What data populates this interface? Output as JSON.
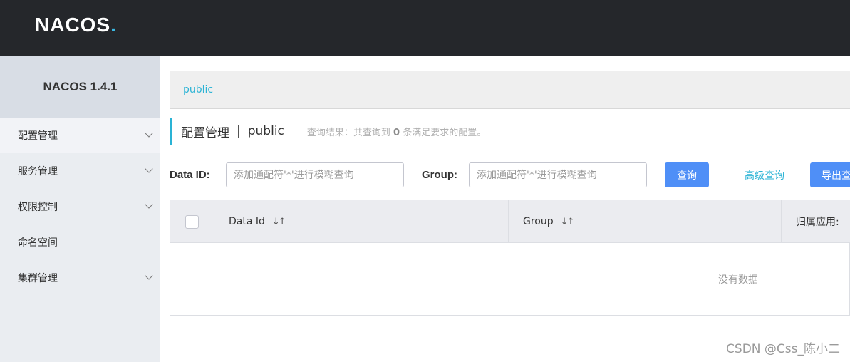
{
  "header": {
    "logo_text_na": "NA",
    "logo_text_cos": "COS",
    "logo_dot": "."
  },
  "sidebar": {
    "version": "NACOS 1.4.1",
    "items": [
      {
        "label": "配置管理",
        "has_chevron": true,
        "active": true
      },
      {
        "label": "服务管理",
        "has_chevron": true
      },
      {
        "label": "权限控制",
        "has_chevron": true
      },
      {
        "label": "命名空间",
        "has_chevron": false
      },
      {
        "label": "集群管理",
        "has_chevron": true
      }
    ]
  },
  "breadcrumb": {
    "namespace": "public"
  },
  "title": {
    "text": "配置管理",
    "separator": "|",
    "namespace": "public",
    "result_prefix": "查询结果：共查询到",
    "result_count": "0",
    "result_suffix": "条满足要求的配置。"
  },
  "search": {
    "data_id_label": "Data ID:",
    "data_id_placeholder": "添加通配符'*'进行模糊查询",
    "group_label": "Group:",
    "group_placeholder": "添加通配符'*'进行模糊查询",
    "query_button": "查询",
    "advanced_query": "高级查询",
    "export_button": "导出查"
  },
  "table": {
    "columns": [
      "Data Id",
      "Group",
      "归属应用:"
    ],
    "empty_text": "没有数据"
  },
  "watermark": "CSDN @Css_陈小二",
  "colors": {
    "accent": "#2ab3d5",
    "primary_button": "#4f8ff7",
    "topbar": "#25272b"
  }
}
